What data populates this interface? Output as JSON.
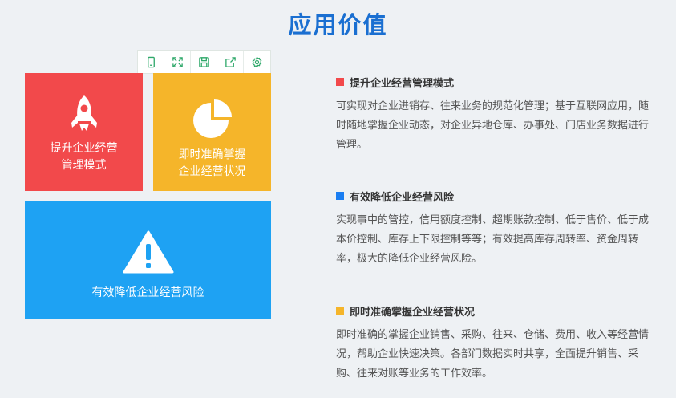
{
  "page": {
    "title": "应用价值"
  },
  "toolbar": {
    "items": [
      {
        "name": "mobile-icon"
      },
      {
        "name": "fullscreen-icon"
      },
      {
        "name": "save-icon"
      },
      {
        "name": "share-icon"
      },
      {
        "name": "settings-icon"
      }
    ]
  },
  "tiles": {
    "red": {
      "label": "提升企业经营管理模式",
      "color": "#f2494b",
      "icon": "rocket-icon"
    },
    "yellow": {
      "label": "即时准确掌握企业经营状况",
      "color": "#f5b52a",
      "icon": "pie-chart-icon"
    },
    "blue": {
      "label": "有效降低企业经营风险",
      "color": "#1ea2f3",
      "icon": "warning-icon"
    }
  },
  "sections": [
    {
      "color": "#f2494b",
      "heading": "提升企业经营管理模式",
      "body": "可实现对企业进销存、往来业务的规范化管理；基于互联网应用，随时随地掌握企业动态，对企业异地仓库、办事处、门店业务数据进行管理。"
    },
    {
      "color": "#1a7ef2",
      "heading": "有效降低企业经营风险",
      "body": "实现事中的管控，信用额度控制、超期账款控制、低于售价、低于成本价控制、库存上下限控制等等；有效提高库存周转率、资金周转率，极大的降低企业经营风险。"
    },
    {
      "color": "#f5b52a",
      "heading": "即时准确掌握企业经营状况",
      "body": "即时准确的掌握企业销售、采购、往来、仓储、费用、收入等经营情况，帮助企业快速决策。各部门数据实时共享，全面提升销售、采购、往来对账等业务的工作效率。"
    }
  ]
}
